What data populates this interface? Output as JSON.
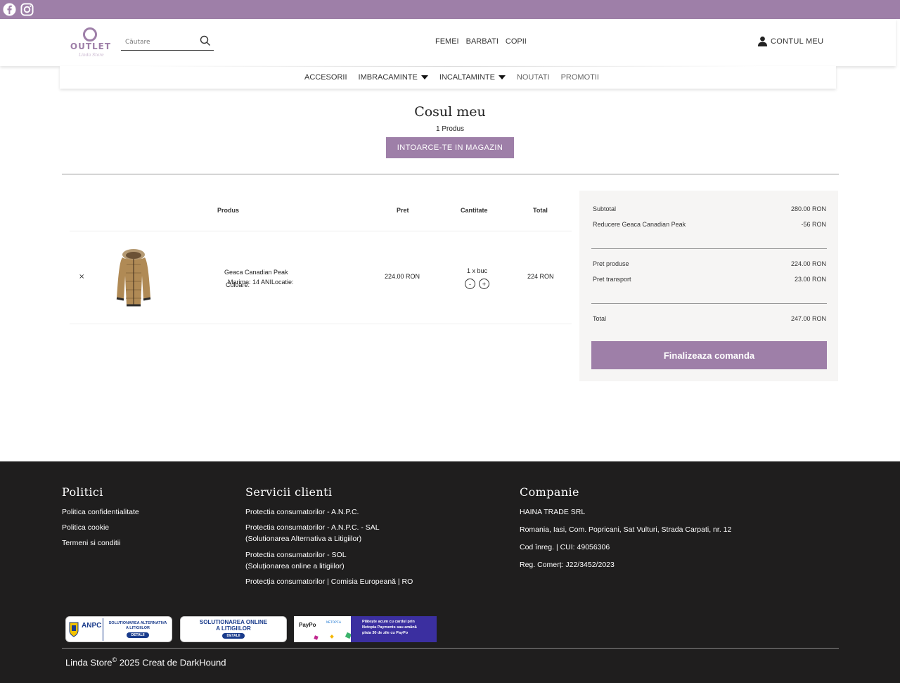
{
  "topbar": {
    "icons": [
      "facebook-icon",
      "instagram-icon"
    ],
    "color": "#9e7fa8"
  },
  "header": {
    "logo_text": "OUTLET",
    "logo_subtext": "Linda Store",
    "search_placeholder": "Căutare",
    "main_nav": [
      "FEMEI",
      "BARBATI",
      "COPII"
    ],
    "account_label": "CONTUL MEU"
  },
  "subnav": {
    "items": [
      {
        "label": "ACCESORII"
      },
      {
        "label": "IMBRACAMINTE"
      },
      {
        "label": "INCALTAMINTE"
      },
      {
        "label": "NOUTATI"
      },
      {
        "label": "PROMOTII"
      }
    ]
  },
  "cart": {
    "title": "Cosul meu",
    "count_label": "1 Produs",
    "back_button": "INTOARCE-TE IN MAGAZIN",
    "columns": {
      "product": "Produs",
      "price": "Pret",
      "quantity": "Cantitate",
      "total": "Total"
    },
    "items": [
      {
        "remove": "×",
        "name": "Geaca Canadian Peak",
        "attr_color": "Culoare:",
        "attr_size": "Marime: 14 ANILocatie:",
        "price": "224.00 RON",
        "qty_text": "1 x buc",
        "minus": "-",
        "plus": "+",
        "total": "224 RON"
      }
    ]
  },
  "summary": {
    "subtotal_label": "Subtotal",
    "subtotal_value": "280.00 RON",
    "discount_label": "Reducere Geaca Canadian Peak",
    "discount_value": "-56 RON",
    "products_label": "Pret produse",
    "products_value": "224.00 RON",
    "shipping_label": "Pret transport",
    "shipping_value": "23.00 RON",
    "total_label": "Total",
    "total_value": "247.00 RON",
    "checkout_button": "Finalizeaza comanda"
  },
  "footer": {
    "politici": {
      "title": "Politici",
      "links": [
        "Politica confidentialitate",
        "Politica cookie",
        "Termeni si conditii"
      ]
    },
    "servicii": {
      "title": "Servicii clienti",
      "links": [
        "Protectia consumatorilor - A.N.P.C.",
        "Protectia consumatorilor - A.N.P.C. - SAL",
        "(Solutionarea Alternativa a Litigiilor)",
        "Protectia consumatorilor - SOL",
        "(Soluționarea online a litigiilor)",
        "Protecția consumatorilor | Comisia Europeană | RO"
      ]
    },
    "companie": {
      "title": "Companie",
      "lines": [
        "HAINA TRADE SRL",
        "Romania, Iasi, Com. Popricani, Sat Vulturi, Strada Carpati, nr. 12",
        "Cod înreg. | CUI: 49056306",
        "Reg. Comerț: J22/3452/2023"
      ]
    },
    "badges": {
      "anpc_sal": {
        "brand": "ANPC",
        "text1": "SOLUTIONAREA ALTERNATIVA",
        "text2": "A LITIGIILOR",
        "btn": "DETALII"
      },
      "anpc_sol": {
        "text1": "SOLUTIONAREA ONLINE",
        "text2": "A LITIGIILOR",
        "btn": "DETALII"
      },
      "netopia": {
        "brand1": "PayPo",
        "brand2": "NETOPIA",
        "text1": "Plătește acum cu cardul prin",
        "text2": "Netopia Payments sau amână",
        "text3": "plata 30 de zile cu PayPo"
      }
    },
    "copyright_brand": "Linda Store",
    "copyright_symbol": "©",
    "copyright_rest": " 2025 Creat de DarkHound"
  },
  "colors": {
    "accent": "#9e7fa8",
    "footer_bg": "#1f1e1e",
    "summary_bg": "#f6f5f4"
  }
}
